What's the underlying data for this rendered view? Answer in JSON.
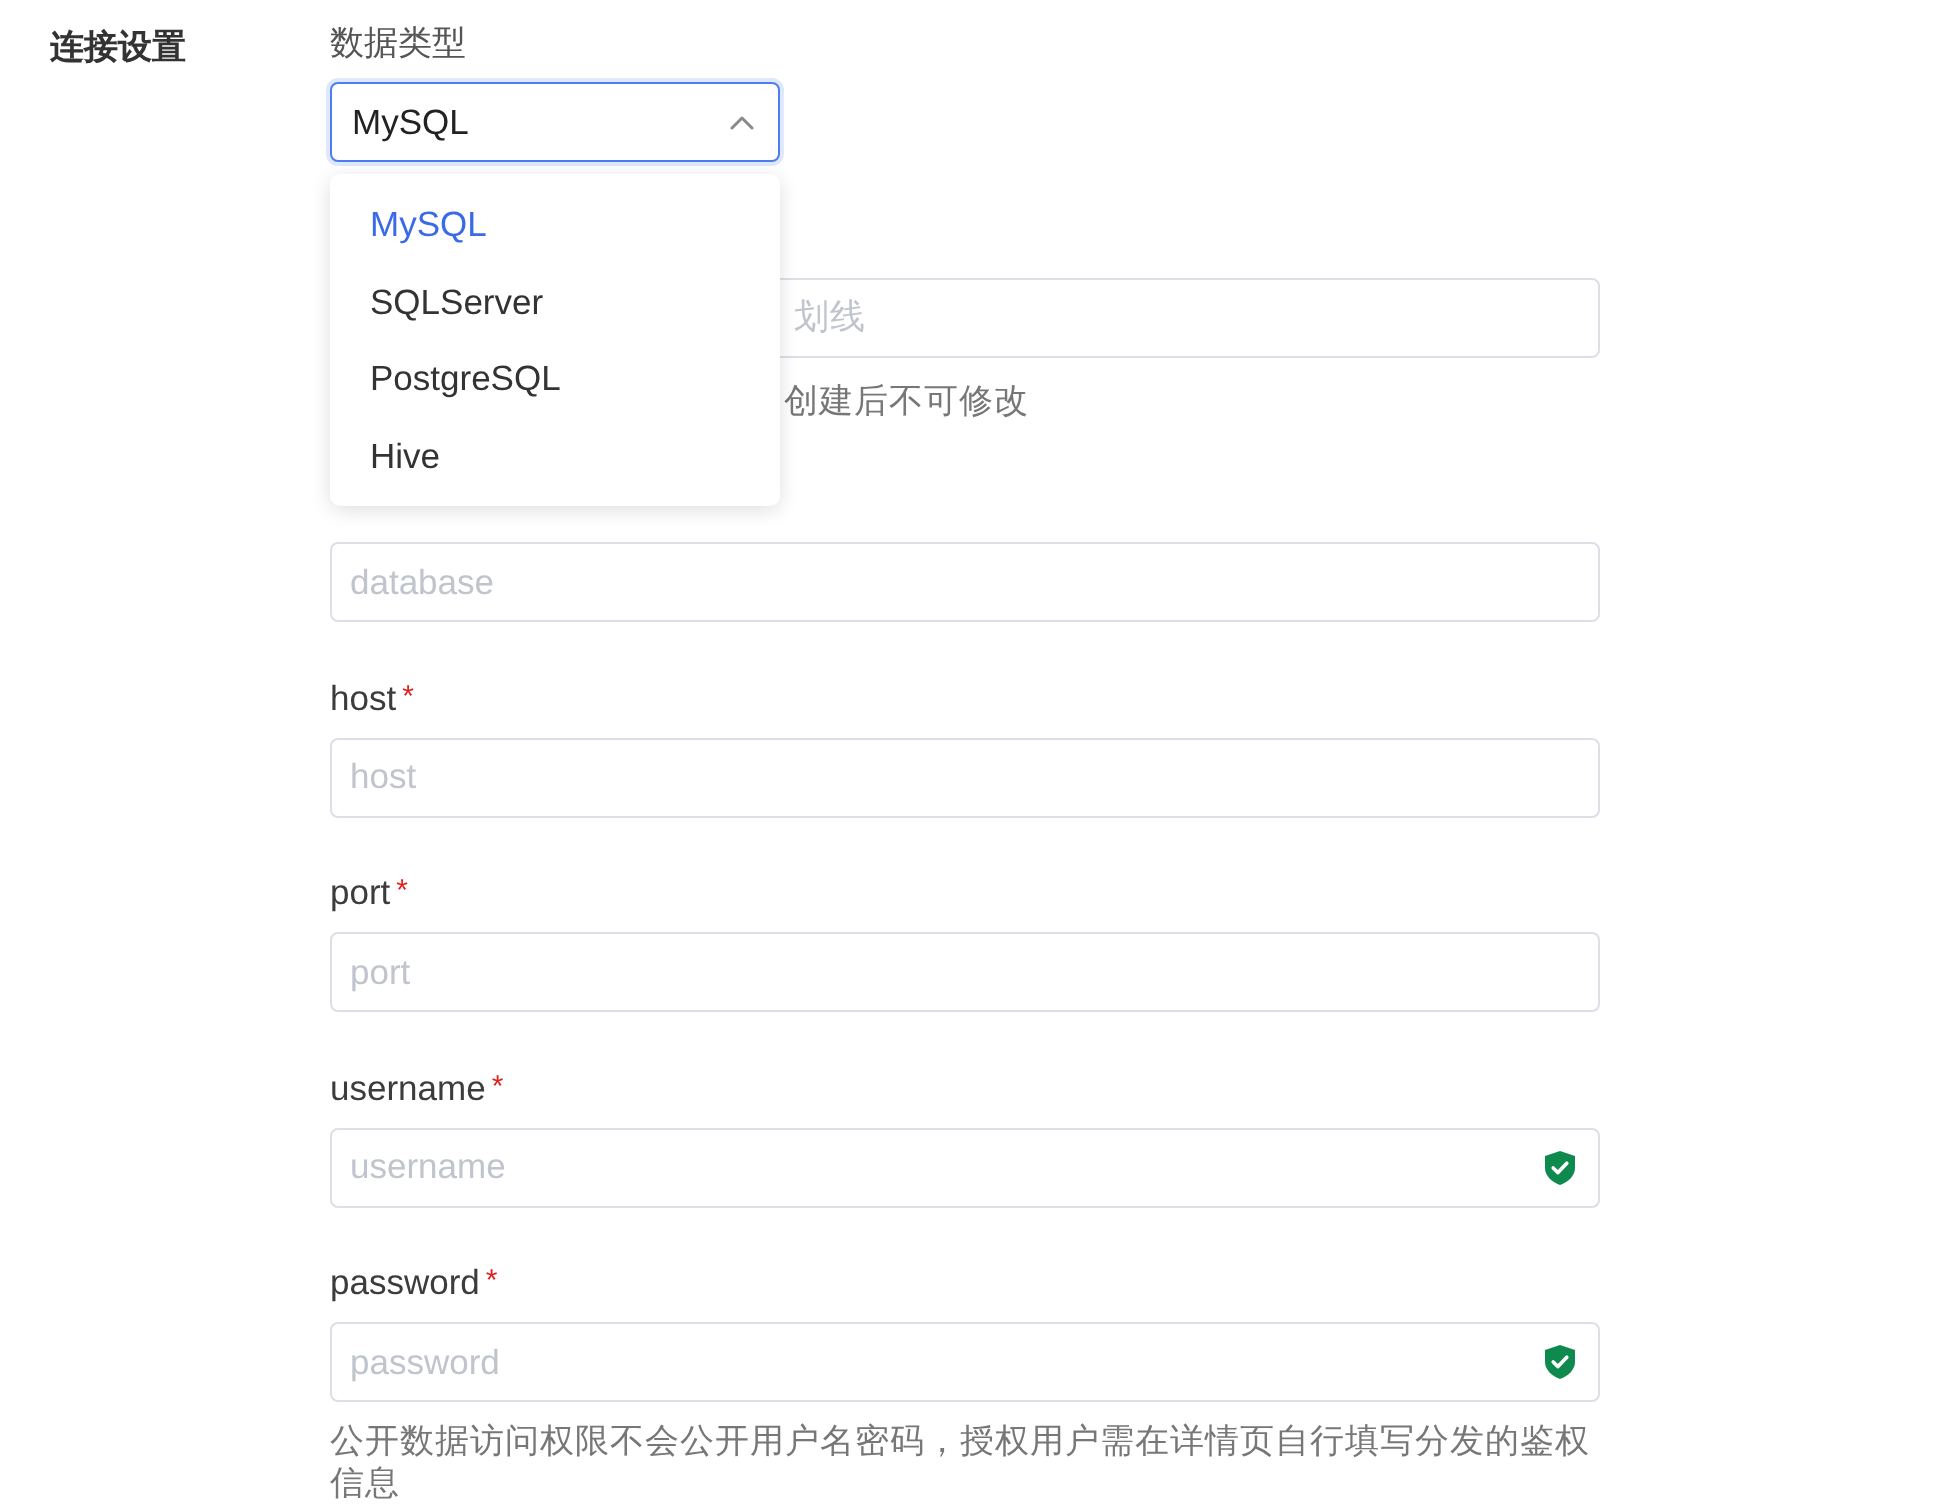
{
  "section": {
    "title": "连接设置"
  },
  "data_type": {
    "label": "数据类型",
    "value": "MySQL",
    "expanded": true,
    "options": [
      {
        "label": "MySQL",
        "selected": true
      },
      {
        "label": "SQLServer",
        "selected": false
      },
      {
        "label": "PostgreSQL",
        "selected": false
      },
      {
        "label": "Hive",
        "selected": false
      }
    ]
  },
  "fields": [
    {
      "kind": "covered",
      "placeholder": "划线",
      "help": "创建后不可修改",
      "protected": false
    },
    {
      "kind": "plain",
      "placeholder": "database",
      "protected": false
    },
    {
      "kind": "plain",
      "label": "host",
      "required_mark": "*",
      "placeholder": "host",
      "protected": false
    },
    {
      "kind": "plain",
      "label": "port",
      "required_mark": "*",
      "placeholder": "port",
      "protected": false
    },
    {
      "kind": "plain",
      "label": "username",
      "required_mark": "*",
      "placeholder": "username",
      "protected": true
    },
    {
      "kind": "plain",
      "label": "password",
      "required_mark": "*",
      "placeholder": "password",
      "protected": true,
      "help": "公开数据访问权限不会公开用户名密码，授权用户需在详情页自行填写分发的鉴权信息"
    }
  ]
}
